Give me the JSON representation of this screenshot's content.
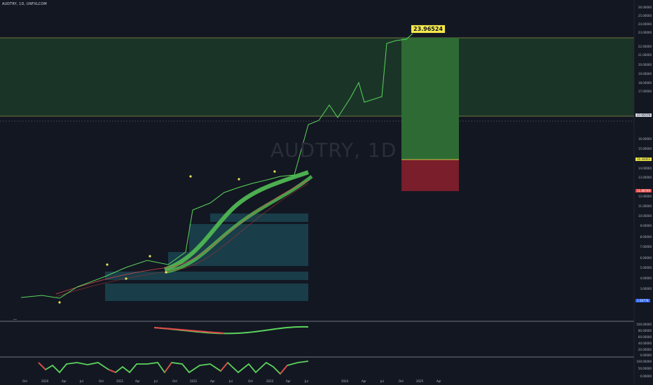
{
  "header": {
    "title": "AUDTRY, 1D, UNFXLCOM"
  },
  "watermark": "AUDTRY, 1D",
  "target_label": "23.96524",
  "price_axis": [
    "26.00000",
    "25.00000",
    "24.00000",
    "23.00000",
    "22.00000",
    "21.00000",
    "20.00000",
    "19.00000",
    "18.00000",
    "17.00000",
    "16.00000",
    "15.00000",
    "14.00000",
    "13.00000",
    "12.00000",
    "11.00000",
    "10.00000",
    "9.00000",
    "8.00000",
    "7.00000",
    "6.00000",
    "5.00000",
    "4.00000",
    "3.00000"
  ],
  "osc1_axis": [
    "100.00000",
    "80.00000",
    "60.00000",
    "40.00000",
    "20.00000",
    "0.00000"
  ],
  "osc2_axis": [
    "100.00000",
    "50.00000",
    "0.00000"
  ],
  "time_axis": [
    "Oct",
    "2020",
    "Apr",
    "Jul",
    "Oct",
    "2021",
    "Apr",
    "Jul",
    "Oct",
    "2022",
    "Apr",
    "Jul",
    "Oct",
    "2023",
    "Apr",
    "Jul",
    "2024",
    "Apr",
    "Jul",
    "Oct",
    "2025",
    "Apr"
  ],
  "badges": {
    "current_price": "17.95579",
    "stop_price": "16.44003",
    "lower_price": "11.89749",
    "low_price": "3.58778"
  },
  "colors": {
    "profit_zone": "#1e5c2e",
    "loss_zone": "#7a1e2b",
    "green_band": "#4caf50",
    "target_label": "#f5e94a",
    "price_line": "#5bd45b"
  },
  "icons": {
    "pane_toggle": "snake-icon"
  }
}
